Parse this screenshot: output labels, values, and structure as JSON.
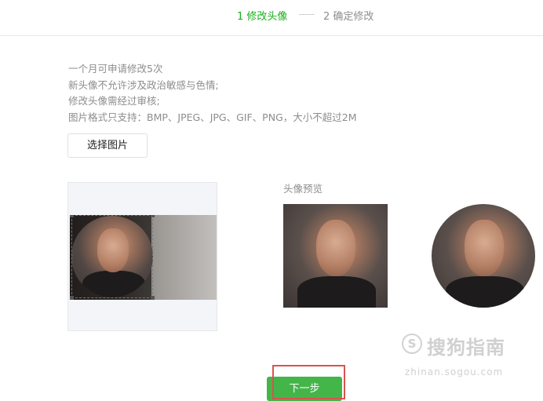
{
  "steps": {
    "step1_label": "1 修改头像",
    "step2_label": "2 确定修改"
  },
  "rules": [
    "一个月可申请修改5次",
    "新头像不允许涉及政治敏感与色情;",
    "修改头像需经过审核;",
    "图片格式只支持：BMP、JPEG、JPG、GIF、PNG，大小不超过2M"
  ],
  "select_button_label": "选择图片",
  "preview_label": "头像预览",
  "next_button_label": "下一步",
  "watermark": {
    "logo_char": "S",
    "text": "搜狗指南",
    "url": "zhinan.sogou.com"
  },
  "colors": {
    "step_active": "#1aad19",
    "step_inactive": "#8d8d8d",
    "primary_button": "#44b549",
    "highlight_box": "#d9534f"
  }
}
